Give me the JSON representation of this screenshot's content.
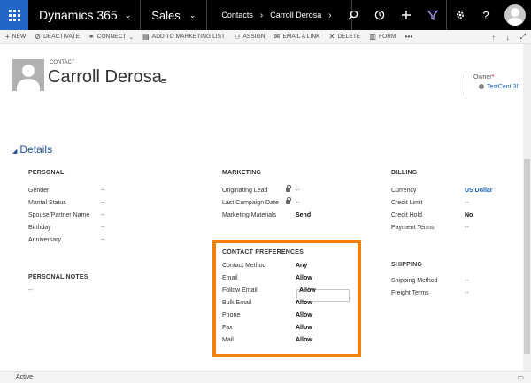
{
  "topnav": {
    "brand": "Dynamics 365",
    "app": "Sales",
    "breadcrumb": [
      "Contacts",
      "Carroll Derosa"
    ],
    "icons": [
      "search-icon",
      "history-icon",
      "add-icon",
      "filter-icon",
      "settings-icon",
      "help-icon",
      "user-avatar"
    ]
  },
  "commands": [
    {
      "icon": "+",
      "label": "NEW"
    },
    {
      "icon": "⊘",
      "label": "DEACTIVATE"
    },
    {
      "icon": "⚭",
      "label": "CONNECT",
      "chev": "⌄"
    },
    {
      "icon": "▤",
      "label": "ADD TO MARKETING LIST"
    },
    {
      "icon": "⚇",
      "label": "ASSIGN"
    },
    {
      "icon": "✉",
      "label": "EMAIL A LINK"
    },
    {
      "icon": "✕",
      "label": "DELETE"
    },
    {
      "icon": "▥",
      "label": "FORM"
    },
    {
      "icon": "",
      "label": "•••"
    }
  ],
  "record": {
    "type": "CONTACT",
    "name": "Carroll Derosa",
    "owner_label": "Owner",
    "owner_required": "*",
    "owner_value": "TestCent 3!!"
  },
  "details_title": "Details",
  "personal": {
    "title": "PERSONAL",
    "rows": [
      {
        "label": "Gender",
        "value": "--"
      },
      {
        "label": "Marital Status",
        "value": "--"
      },
      {
        "label": "Spouse/Partner Name",
        "value": "--"
      },
      {
        "label": "Birthday",
        "value": "--"
      },
      {
        "label": "Anniversary",
        "value": "--"
      }
    ]
  },
  "personal_notes": {
    "title": "PERSONAL NOTES",
    "value": "--"
  },
  "marketing": {
    "title": "MARKETING",
    "rows": [
      {
        "label": "Originating Lead",
        "value": "--",
        "locked": true
      },
      {
        "label": "Last Campaign Date",
        "value": "--",
        "locked": true
      },
      {
        "label": "Marketing Materials",
        "value": "Send",
        "locked": false
      }
    ]
  },
  "contact_preferences": {
    "title": "CONTACT PREFERENCES",
    "rows": [
      {
        "label": "Contact Method",
        "value": "Any"
      },
      {
        "label": "Email",
        "value": "Allow"
      },
      {
        "label": "Follow Email",
        "value": "Allow"
      },
      {
        "label": "Bulk Email",
        "value": "Allow"
      },
      {
        "label": "Phone",
        "value": "Allow"
      },
      {
        "label": "Fax",
        "value": "Allow"
      },
      {
        "label": "Mail",
        "value": "Allow"
      }
    ]
  },
  "billing": {
    "title": "BILLING",
    "rows": [
      {
        "label": "Currency",
        "value": "US Dollar"
      },
      {
        "label": "Credit Limit",
        "value": "--"
      },
      {
        "label": "Credit Hold",
        "value": "No"
      },
      {
        "label": "Payment Terms",
        "value": "--"
      }
    ]
  },
  "shipping": {
    "title": "SHIPPING",
    "rows": [
      {
        "label": "Shipping Method",
        "value": "--"
      },
      {
        "label": "Freight Terms",
        "value": "--"
      }
    ]
  },
  "status": "Active",
  "colors": {
    "nav": "#000000",
    "waffle": "#2266c8",
    "highlight": "#f07f0e",
    "link": "#1560ae"
  }
}
